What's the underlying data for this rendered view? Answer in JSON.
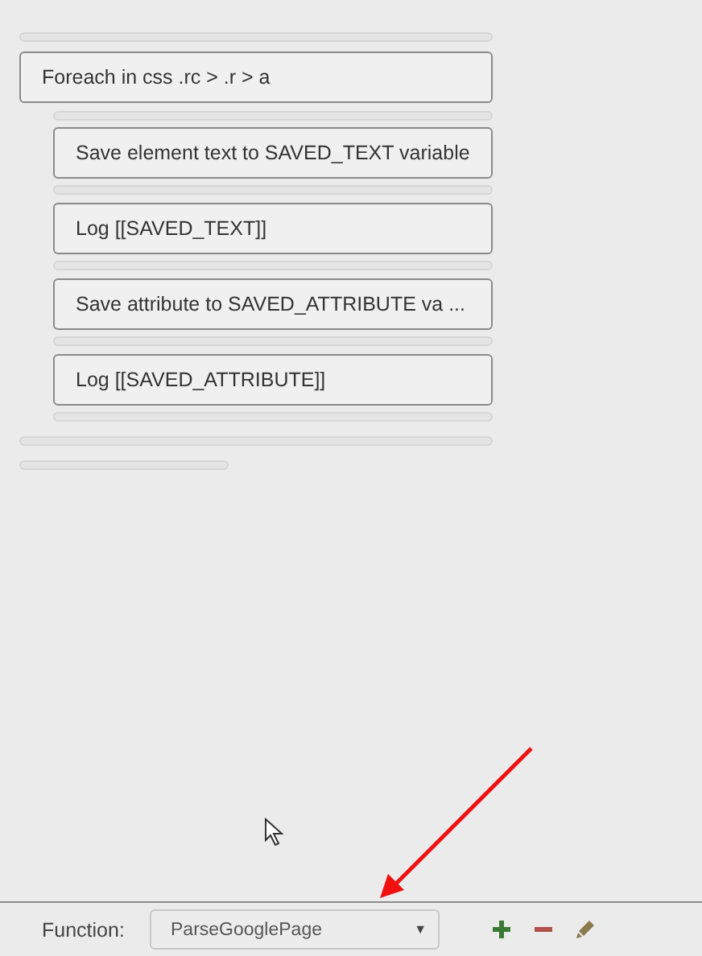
{
  "blocks": [
    {
      "label": "Foreach in css .rc > .r > a",
      "children": [
        {
          "label": "Save element text to SAVED_TEXT variable"
        },
        {
          "label": "Log [[SAVED_TEXT]]"
        },
        {
          "label": "Save attribute to SAVED_ATTRIBUTE va ..."
        },
        {
          "label": "Log [[SAVED_ATTRIBUTE]]"
        }
      ]
    }
  ],
  "footer": {
    "label": "Function:",
    "select": {
      "value": "ParseGooglePage",
      "caret": "▼"
    },
    "actions": [
      {
        "kind": "add"
      },
      {
        "kind": "remove"
      },
      {
        "kind": "edit"
      }
    ]
  }
}
